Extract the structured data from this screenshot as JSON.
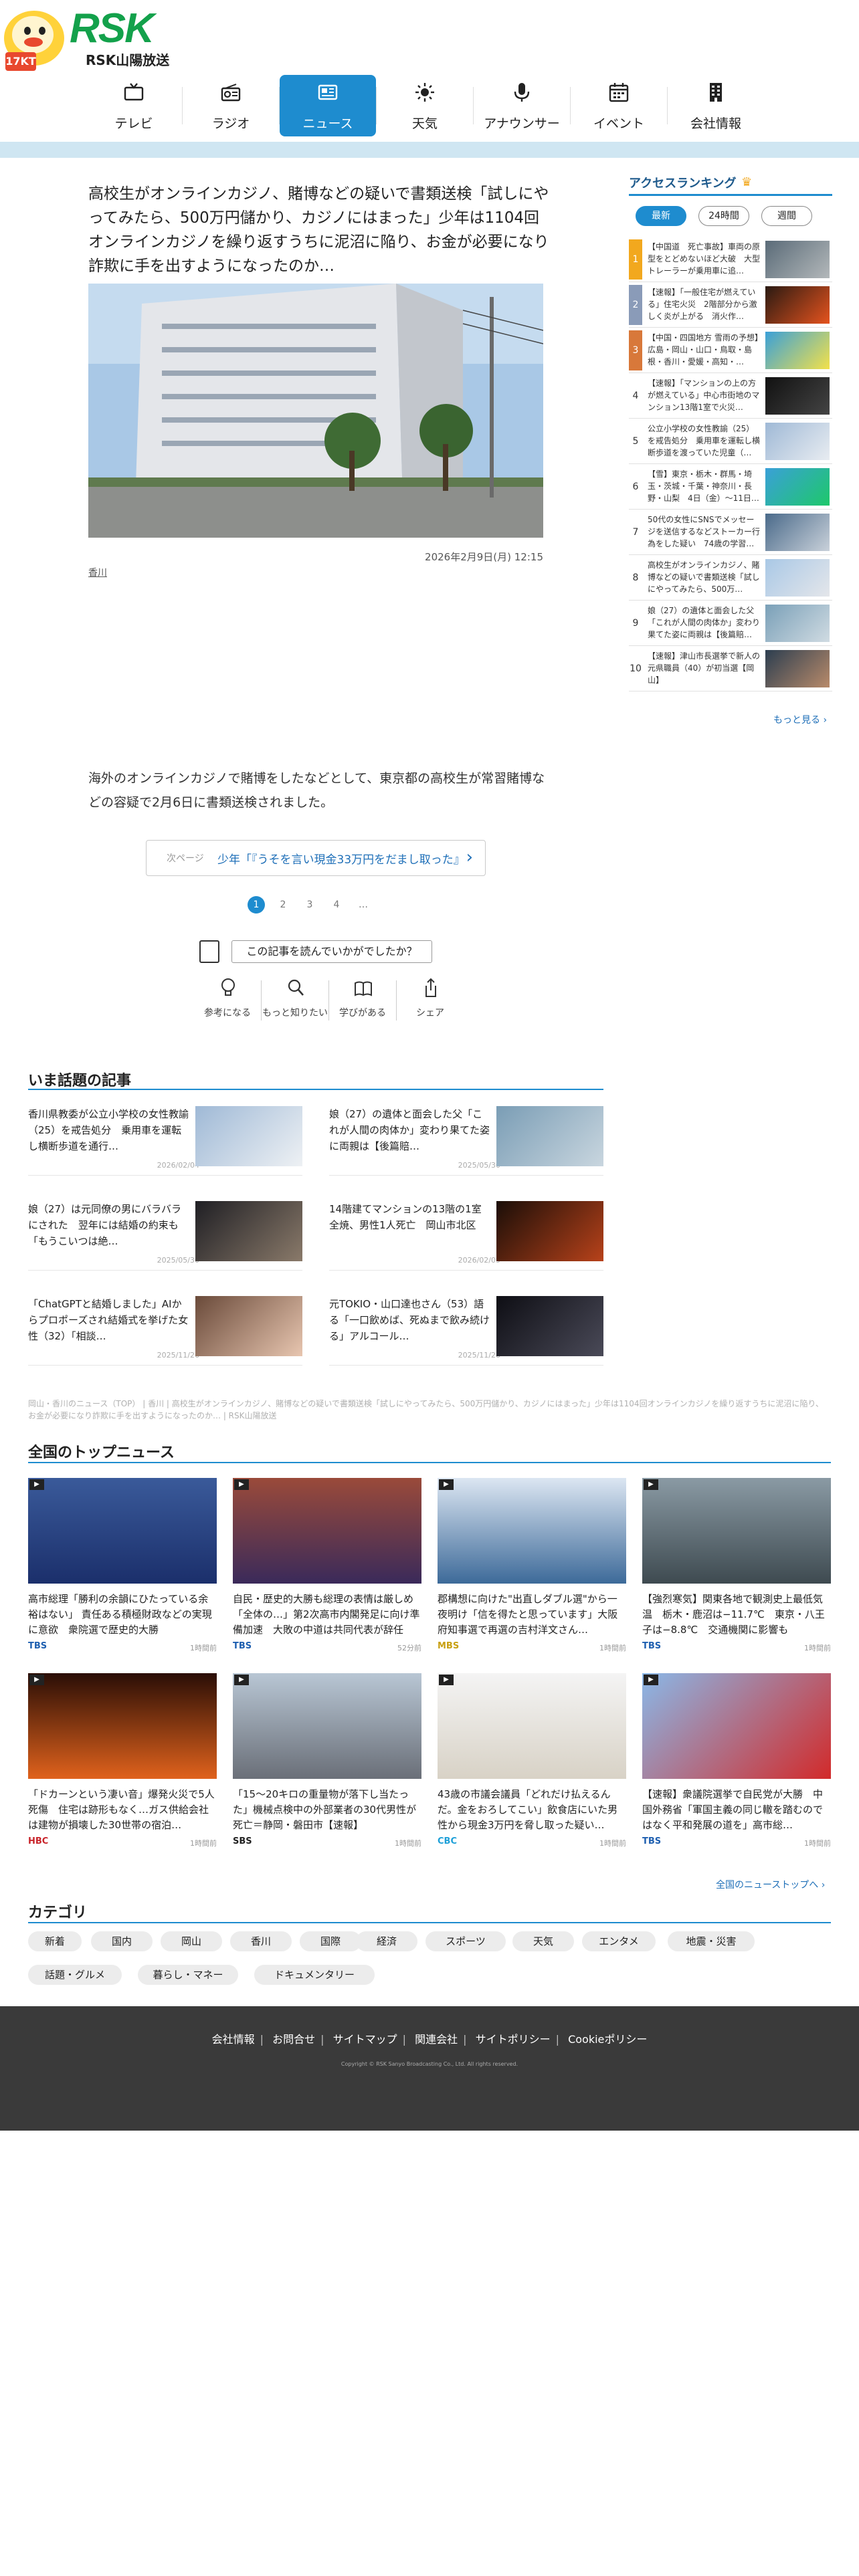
{
  "brand": {
    "logo_text": "RSK",
    "sub_text": "RSK山陽放送",
    "mascot_tag": "17KT"
  },
  "nav": [
    {
      "label": "テレビ",
      "icon": "tv-icon"
    },
    {
      "label": "ラジオ",
      "icon": "radio-icon"
    },
    {
      "label": "ニュース",
      "icon": "news-icon",
      "active": true
    },
    {
      "label": "天気",
      "icon": "sun-icon"
    },
    {
      "label": "アナウンサー",
      "icon": "microphone-icon"
    },
    {
      "label": "イベント",
      "icon": "calendar-icon"
    },
    {
      "label": "会社情報",
      "icon": "building-icon"
    }
  ],
  "article": {
    "title": "高校生がオンラインカジノ、賭博などの疑いで書類送検「試しにやってみたら、500万円儲かり、カジノにはまった」少年は1104回オンラインカジノを繰り返すうちに泥沼に陥り、お金が必要になり詐欺に手を出すようになったのか…",
    "date": "2026年2月9日(月) 12:15",
    "area": "香川",
    "body": "海外のオンラインカジノで賭博をしたなどとして、東京都の高校生が常習賭博などの容疑で2月6日に書類送検されました。",
    "next_label": "次ページ",
    "next_title": "少年「『うそを言い現金33万円をだまし取った』",
    "next_arrow": "›",
    "pages": [
      "1",
      "2",
      "3",
      "4",
      "…"
    ],
    "question": "この記事を読んでいかがでしたか？",
    "reactions": [
      {
        "label": "参考になる",
        "icon": "lightbulb-icon"
      },
      {
        "label": "もっと知りたい",
        "icon": "magnifier-icon"
      },
      {
        "label": "学びがある",
        "icon": "book-icon"
      },
      {
        "label": "シェア",
        "icon": "share-icon"
      }
    ]
  },
  "ranking": {
    "title": "アクセスランキング",
    "crown": "♛",
    "tabs": [
      "最新",
      "24時間",
      "週間"
    ],
    "items": [
      {
        "rank": "1",
        "text": "【中国道　死亡事故】車両の原型をとどめないほど大破　大型トレーラーが乗用車に追…",
        "color": "#f2a81e"
      },
      {
        "rank": "2",
        "text": "【速報】「一般住宅が燃えている」住宅火災　2階部分から激しく炎が上がる　消火作…",
        "color": "#8a9bb8"
      },
      {
        "rank": "3",
        "text": "【中国・四国地方 雪雨の予想】広島・岡山・山口・鳥取・島根・香川・愛媛・高知・…",
        "color": "#d8783a"
      },
      {
        "rank": "4",
        "text": "【速報】「マンションの上の方が燃えている」中心市街地のマンション13階1室で火災…",
        "color": ""
      },
      {
        "rank": "5",
        "text": "公立小学校の女性教諭（25）を戒告処分　乗用車を運転し横断歩道を渡っていた児童（…",
        "color": ""
      },
      {
        "rank": "6",
        "text": "【雪】東京・栃木・群馬・埼玉・茨城・千葉・神奈川・長野・山梨　4日（金）〜11日…",
        "color": ""
      },
      {
        "rank": "7",
        "text": "50代の女性にSNSでメッセージを送信するなどストーカー行為をした疑い　74歳の学習…",
        "color": ""
      },
      {
        "rank": "8",
        "text": "高校生がオンラインカジノ、賭博などの疑いで書類送検「試しにやってみたら、500万…",
        "color": ""
      },
      {
        "rank": "9",
        "text": "娘（27）の遺体と面会した父「これが人間の肉体か」変わり果てた姿に両親は【後篇賠…",
        "color": ""
      },
      {
        "rank": "10",
        "text": "【速報】津山市長選挙で新人の元県職員（40）が初当選【岡山】",
        "color": ""
      }
    ],
    "more": "もっと見る ›"
  },
  "trending": {
    "heading": "いま話題の記事",
    "items": [
      {
        "text": "香川県教委が公立小学校の女性教諭（25）を戒告処分　乗用車を運転し横断歩道を通行…",
        "date": "2026/02/04"
      },
      {
        "text": "娘（27）の遺体と面会した父「これが人間の肉体か」変わり果てた姿に両親は【後篇賠…",
        "date": "2025/05/30"
      },
      {
        "text": "娘（27）は元同僚の男にバラバラにされた　翌年には結婚の約束も「もうこいつは絶…",
        "date": "2025/05/30"
      },
      {
        "text": "14階建てマンションの13階の1室全焼、男性1人死亡　岡山市北区",
        "date": "2026/02/09"
      },
      {
        "text": "「ChatGPTと結婚しました」AIからプロポーズされ結婚式を挙げた女性（32）「相談…",
        "date": "2025/11/26"
      },
      {
        "text": "元TOKIO・山口達也さん（53）語る「一口飲めば、死ぬまで飲み続ける」アルコール…",
        "date": "2025/11/28"
      }
    ]
  },
  "breadcrumb": "岡山・香川のニュース（TOP） | 香川 | 高校生がオンラインカジノ、賭博などの疑いで書類送検「試しにやってみたら、500万円儲かり、カジノにはまった」少年は1104回オンラインカジノを繰り返すうちに泥沼に陥り、お金が必要になり詐欺に手を出すようになったのか… | RSK山陽放送",
  "top_news": {
    "heading": "全国のトップニュース",
    "items": [
      {
        "title": "高市総理「勝利の余韻にひたっている余裕はない」 責任ある積極財政などの実現に意欲　衆院選で歴史的大勝",
        "source": "TBS",
        "time": "1時間前",
        "color": "#1b2f6b"
      },
      {
        "title": "自民・歴史的大勝も総理の表情は厳しめ「全体の…」第2次高市内閣発足に向け準備加速　大敗の中道は共同代表が辞任「…",
        "source": "TBS",
        "time": "52分前",
        "color": "#7a2a2a"
      },
      {
        "title": "郡構想に向けた\"出直しダブル選\"から一夜明け「信を得たと思っています」大阪府知事選で再選の吉村洋文さん…",
        "source": "MBS",
        "time": "1時間前",
        "color": "#3d6a99"
      },
      {
        "title": "【強烈寒気】関東各地で観測史上最低気温　栃木・鹿沼は−11.7℃　東京・八王子は−8.8℃　交通機関に影響も",
        "source": "TBS",
        "time": "1時間前",
        "color": "#5d6b73"
      },
      {
        "title": "「ドカーンという凄い音」爆発火災で5人死傷　住宅は跡形もなく…ガス供給会社は建物が損壊した30世帯の宿泊…",
        "source": "HBC",
        "time": "1時間前",
        "color": "#8a3a12"
      },
      {
        "title": "「15〜20キロの重量物が落下し当たった」機械点検中の外部業者の30代男性が死亡＝静岡・磐田市【速報】",
        "source": "SBS",
        "time": "1時間前",
        "color": "#6a6f78"
      },
      {
        "title": "43歳の市議会議員「どれだけ払えるんだ。金をおろしてこい」飲食店にいた男性から現金3万円を脅し取った疑い…",
        "source": "CBC",
        "time": "1時間前",
        "color": "#d8d2c6"
      },
      {
        "title": "【速報】衆議院選挙で自民党が大勝　中国外務省「軍国主義の同じ轍を踏むのではなく平和発展の道を」高市総…",
        "source": "TBS",
        "time": "1時間前",
        "color": "#b8242a"
      }
    ],
    "all_link": "全国のニューストップへ ›"
  },
  "category": {
    "heading": "カテゴリ",
    "chips": [
      "新着",
      "国内",
      "岡山",
      "香川",
      "国際",
      "経済",
      "スポーツ",
      "天気",
      "エンタメ",
      "地震・災害",
      "話題・グルメ",
      "暮らし・マネー",
      "ドキュメンタリー"
    ]
  },
  "footer": {
    "links": [
      "会社情報",
      "お問合せ",
      "サイトマップ",
      "関連会社",
      "サイトポリシー",
      "Cookieポリシー"
    ],
    "copyright": "Copyright © RSK Sanyo Broadcasting Co., Ltd. All rights reserved."
  },
  "colors": {
    "accent": "#1e8ccf",
    "brand_green": "#13a14b",
    "rank1": "#f2a81e",
    "rank2": "#8a9bb8",
    "rank3": "#d8783a",
    "footer": "#3a3a3a"
  }
}
